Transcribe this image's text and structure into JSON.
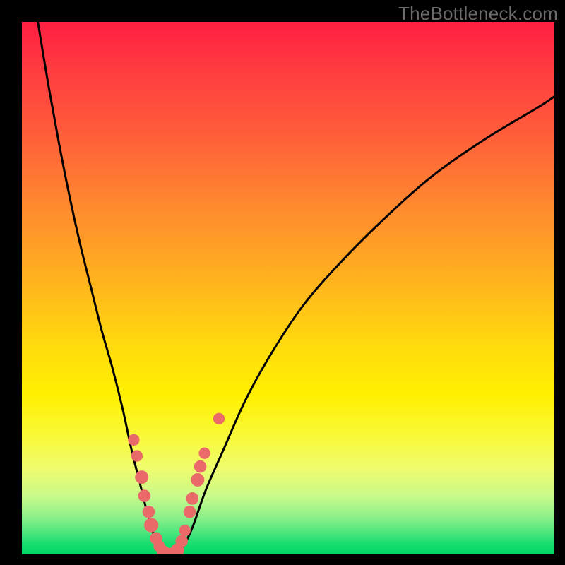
{
  "watermark": "TheBottleneck.com",
  "chart_data": {
    "type": "line",
    "title": "",
    "xlabel": "",
    "ylabel": "",
    "xlim": [
      0,
      100
    ],
    "ylim": [
      0,
      100
    ],
    "grid": false,
    "legend": false,
    "background_gradient": {
      "direction": "vertical",
      "stops": [
        {
          "pos": 0.0,
          "color": "#ff1f41"
        },
        {
          "pos": 0.5,
          "color": "#ffc015"
        },
        {
          "pos": 0.75,
          "color": "#fff000"
        },
        {
          "pos": 1.0,
          "color": "#00d764"
        }
      ]
    },
    "series": [
      {
        "name": "left-arm",
        "style": "curve",
        "color": "#000000",
        "x": [
          3,
          5,
          7,
          9,
          11,
          13,
          15,
          17,
          19,
          20.5,
          22,
          23.5,
          25,
          26,
          26.8
        ],
        "y": [
          100,
          88,
          77,
          67,
          58,
          50,
          42,
          35,
          27,
          20,
          14,
          8,
          3,
          0.8,
          0
        ]
      },
      {
        "name": "right-arm",
        "style": "curve",
        "color": "#000000",
        "x": [
          28.8,
          30,
          32,
          34.5,
          38,
          42,
          47,
          53,
          60,
          68,
          77,
          87,
          97,
          100
        ],
        "y": [
          0,
          1,
          5,
          12,
          20,
          29,
          38,
          47,
          55,
          63,
          71,
          78,
          84,
          86
        ]
      },
      {
        "name": "floor",
        "style": "curve",
        "color": "#000000",
        "x": [
          26.8,
          27.4,
          28.1,
          28.8
        ],
        "y": [
          0,
          0,
          0,
          0
        ]
      }
    ],
    "markers": [
      {
        "name": "cluster-dots",
        "color": "#ea6a6a",
        "points": [
          {
            "x": 21.0,
            "y": 21.5,
            "r": 1.2
          },
          {
            "x": 21.6,
            "y": 18.5,
            "r": 1.2
          },
          {
            "x": 22.5,
            "y": 14.5,
            "r": 1.4
          },
          {
            "x": 23.0,
            "y": 11.0,
            "r": 1.3
          },
          {
            "x": 23.8,
            "y": 8.0,
            "r": 1.3
          },
          {
            "x": 24.3,
            "y": 5.5,
            "r": 1.5
          },
          {
            "x": 25.2,
            "y": 3.0,
            "r": 1.3
          },
          {
            "x": 25.8,
            "y": 1.5,
            "r": 1.2
          },
          {
            "x": 26.6,
            "y": 0.4,
            "r": 1.4
          },
          {
            "x": 27.4,
            "y": 0.0,
            "r": 1.4
          },
          {
            "x": 28.2,
            "y": 0.0,
            "r": 1.4
          },
          {
            "x": 29.2,
            "y": 0.8,
            "r": 1.4
          },
          {
            "x": 30.0,
            "y": 2.5,
            "r": 1.3
          },
          {
            "x": 30.6,
            "y": 4.5,
            "r": 1.2
          },
          {
            "x": 31.5,
            "y": 8.0,
            "r": 1.3
          },
          {
            "x": 32.0,
            "y": 10.5,
            "r": 1.3
          },
          {
            "x": 33.0,
            "y": 14.0,
            "r": 1.4
          },
          {
            "x": 33.5,
            "y": 16.5,
            "r": 1.3
          },
          {
            "x": 34.3,
            "y": 19.0,
            "r": 1.2
          },
          {
            "x": 37.0,
            "y": 25.5,
            "r": 1.2
          }
        ]
      }
    ]
  }
}
